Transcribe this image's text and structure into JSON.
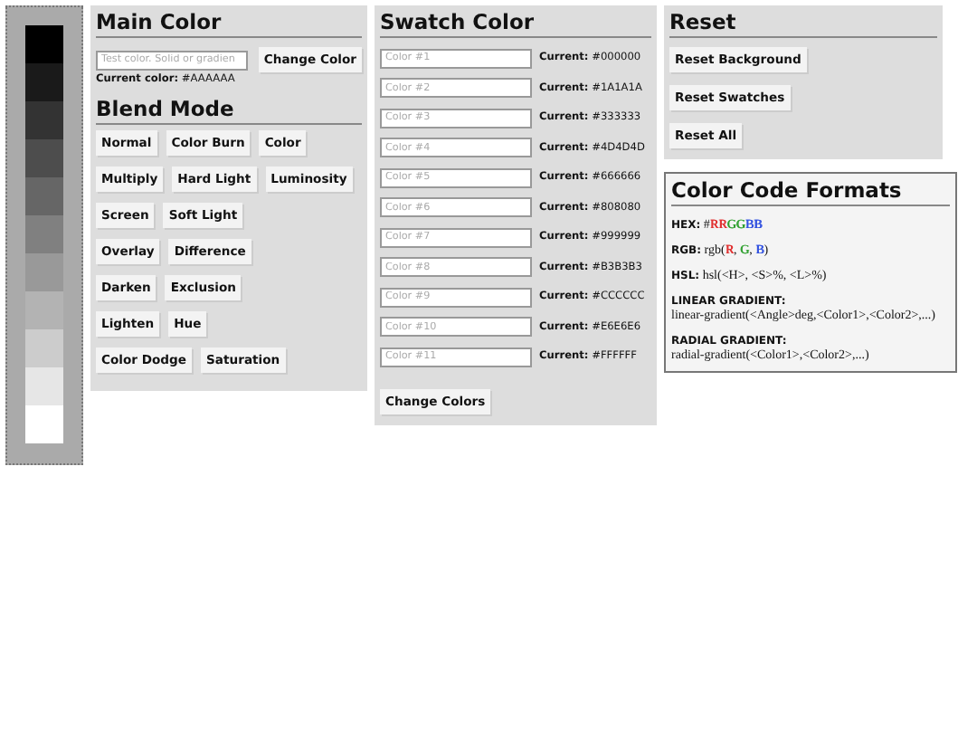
{
  "main_color": {
    "title": "Main Color",
    "input": {
      "placeholder": "Test color. Solid or gradien"
    },
    "button": "Change Color",
    "current_label": "Current color:",
    "current_value": "#AAAAAA"
  },
  "blend_mode": {
    "title": "Blend Mode",
    "rows": [
      [
        "Normal",
        "Color Burn",
        "Color"
      ],
      [
        "Multiply",
        "Hard Light",
        "Luminosity"
      ],
      [
        "Screen",
        "Soft Light"
      ],
      [
        "Overlay",
        "Difference"
      ],
      [
        "Darken",
        "Exclusion"
      ],
      [
        "Lighten",
        "Hue"
      ],
      [
        "Color Dodge",
        "Saturation"
      ]
    ]
  },
  "palette": [
    {
      "color": "#000000"
    },
    {
      "color": "#1a1a1a"
    },
    {
      "color": "#333333"
    },
    {
      "color": "#4d4d4d"
    },
    {
      "color": "#666666"
    },
    {
      "color": "#808080"
    },
    {
      "color": "#999999"
    },
    {
      "color": "#b3b3b3"
    },
    {
      "color": "#cccccc"
    },
    {
      "color": "#e6e6e6"
    },
    {
      "color": "#ffffff"
    }
  ],
  "swatch_color": {
    "title": "Swatch Color",
    "swatches": [
      {
        "placeholder": "Color #1",
        "label": "Current:",
        "value": "#000000"
      },
      {
        "placeholder": "Color #2",
        "label": "Current:",
        "value": "#1A1A1A"
      },
      {
        "placeholder": "Color #3",
        "label": "Current:",
        "value": "#333333"
      },
      {
        "placeholder": "Color #4",
        "label": "Current:",
        "value": "#4D4D4D"
      },
      {
        "placeholder": "Color #5",
        "label": "Current:",
        "value": "#666666"
      },
      {
        "placeholder": "Color #6",
        "label": "Current:",
        "value": "#808080"
      },
      {
        "placeholder": "Color #7",
        "label": "Current:",
        "value": "#999999"
      },
      {
        "placeholder": "Color #8",
        "label": "Current:",
        "value": "#B3B3B3"
      },
      {
        "placeholder": "Color #9",
        "label": "Current:",
        "value": "#CCCCCC"
      },
      {
        "placeholder": "Color #10",
        "label": "Current:",
        "value": "#E6E6E6"
      },
      {
        "placeholder": "Color #11",
        "label": "Current:",
        "value": "#FFFFFF"
      }
    ],
    "button": "Change Colors"
  },
  "reset": {
    "title": "Reset",
    "buttons": [
      "Reset Background",
      "Reset Swatches",
      "Reset All"
    ]
  },
  "formats": {
    "title": "Color Code Formats",
    "items": [
      {
        "label": "HEX:",
        "inline": true,
        "parts": [
          {
            "text": "#"
          },
          {
            "text": "RR",
            "color": "#e03030"
          },
          {
            "text": "GG",
            "color": "#30a030"
          },
          {
            "text": "BB",
            "color": "#3050e0"
          }
        ]
      },
      {
        "label": "RGB:",
        "inline": true,
        "parts": [
          {
            "text": "rgb("
          },
          {
            "text": "R",
            "color": "#e03030"
          },
          {
            "text": ", "
          },
          {
            "text": "G",
            "color": "#30a030"
          },
          {
            "text": ", "
          },
          {
            "text": "B",
            "color": "#3050e0"
          },
          {
            "text": ")"
          }
        ]
      },
      {
        "label": "HSL:",
        "inline": true,
        "parts": [
          {
            "text": "hsl(<H>, <S>%, <L>%)"
          }
        ]
      },
      {
        "label": "LINEAR GRADIENT:",
        "inline": false,
        "parts": [
          {
            "text": "linear-gradient(<Angle>deg,<Color1>,<Color2>,...)"
          }
        ]
      },
      {
        "label": "RADIAL GRADIENT:",
        "inline": false,
        "parts": [
          {
            "text": "radial-gradient(<Color1>,<Color2>,...)"
          }
        ]
      }
    ]
  }
}
